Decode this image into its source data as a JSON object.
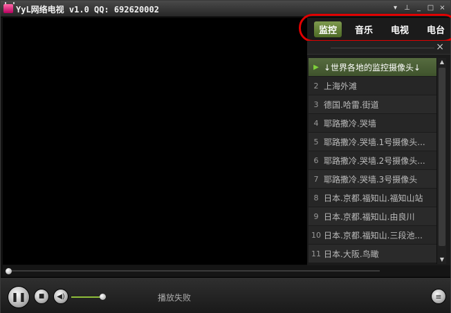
{
  "window": {
    "title": "YyL网络电视 v1.0  QQ: 692620002",
    "controls": {
      "pin": "▾",
      "pushpin": "⊥",
      "minimize": "_",
      "maximize": "□",
      "close": "×"
    }
  },
  "tabs": [
    {
      "label": "监控",
      "active": true
    },
    {
      "label": "音乐",
      "active": false
    },
    {
      "label": "电视",
      "active": false
    },
    {
      "label": "电台",
      "active": false
    }
  ],
  "list_close": "×",
  "channels": [
    {
      "num": "▶",
      "label": "↓世界各地的监控摄像头↓",
      "active": true
    },
    {
      "num": "2",
      "label": "上海外滩"
    },
    {
      "num": "3",
      "label": "德国.哈雷.街道"
    },
    {
      "num": "4",
      "label": "耶路撒冷.哭墙"
    },
    {
      "num": "5",
      "label": "耶路撒冷.哭墙.1号摄像头..."
    },
    {
      "num": "6",
      "label": "耶路撒冷.哭墙.2号摄像头..."
    },
    {
      "num": "7",
      "label": "耶路撒冷.哭墙.3号摄像头"
    },
    {
      "num": "8",
      "label": "日本.京都.福知山.福知山站"
    },
    {
      "num": "9",
      "label": "日本.京都.福知山.由良川"
    },
    {
      "num": "10",
      "label": "日本.京都.福知山.三段池..."
    },
    {
      "num": "11",
      "label": "日本.大阪.鸟瞰"
    }
  ],
  "scroll": {
    "up": "▲",
    "down": "▼"
  },
  "player": {
    "play_icon": "❚❚",
    "stop_icon": "■",
    "volume_icon": "◀)",
    "menu_icon": "≡",
    "status": "播放失败",
    "seek_progress": 0,
    "volume_level": 0.9
  },
  "colors": {
    "accent": "#5a7a35",
    "highlight_ring": "#e00000"
  }
}
